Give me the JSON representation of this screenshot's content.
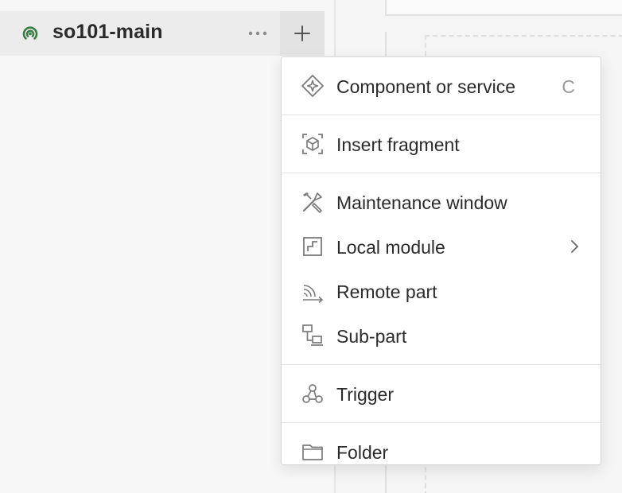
{
  "sidebar": {
    "machine": {
      "name": "so101-main",
      "status_icon": "signal-online-icon",
      "status_color": "#3a7d44",
      "more_icon": "more-horizontal-icon",
      "add_icon": "plus-icon"
    }
  },
  "menu": {
    "sections": [
      {
        "items": [
          {
            "label": "Component or service",
            "icon": "component-diamond-icon",
            "shortcut": "C"
          }
        ]
      },
      {
        "items": [
          {
            "label": "Insert fragment",
            "icon": "fragment-cube-icon"
          }
        ]
      },
      {
        "items": [
          {
            "label": "Maintenance window",
            "icon": "tools-icon"
          },
          {
            "label": "Local module",
            "icon": "module-icon",
            "submenu": true
          },
          {
            "label": "Remote part",
            "icon": "remote-signal-icon"
          },
          {
            "label": "Sub-part",
            "icon": "sub-part-icon"
          }
        ]
      },
      {
        "items": [
          {
            "label": "Trigger",
            "icon": "webhook-trigger-icon"
          }
        ]
      },
      {
        "items": [
          {
            "label": "Folder",
            "icon": "folder-icon"
          }
        ]
      }
    ]
  }
}
